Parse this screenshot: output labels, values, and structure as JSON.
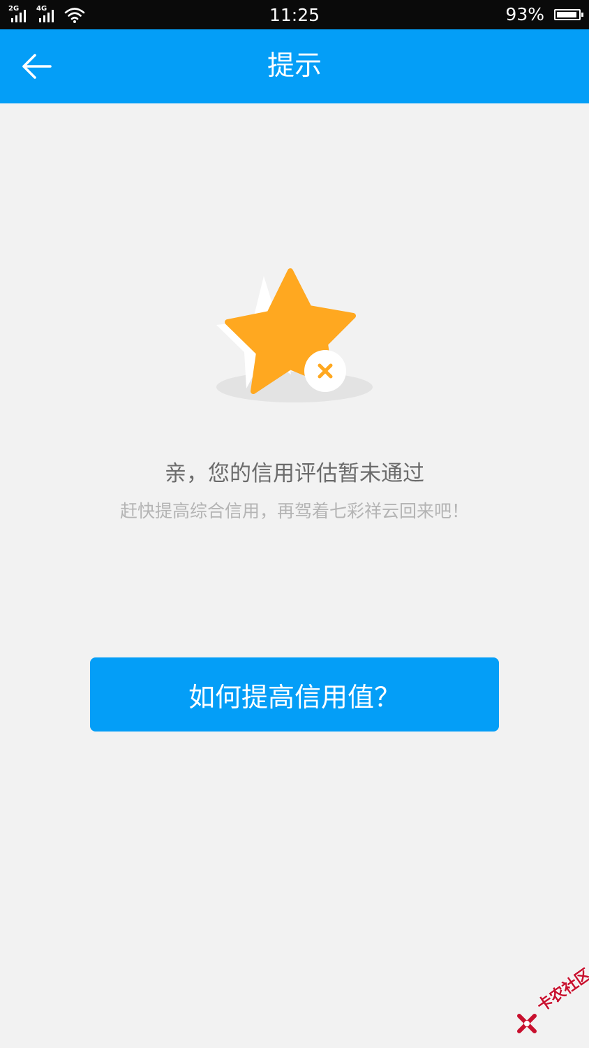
{
  "status_bar": {
    "network_1": "2G",
    "network_2": "4G",
    "time": "11:25",
    "battery": "93%",
    "battery_level": 0.93
  },
  "header": {
    "title": "提示",
    "back_icon": "arrow-left-icon"
  },
  "illustration": {
    "icon": "star-with-x-icon",
    "star_color": "#ffa820",
    "x_color": "#ffa820"
  },
  "message": {
    "title": "亲，您的信用评估暂未通过",
    "subtitle": "赶快提高综合信用，再驾着七彩祥云回来吧！"
  },
  "action": {
    "button_label": "如何提高信用值？"
  },
  "watermark": {
    "text": "卡农社区"
  },
  "colors": {
    "accent": "#049ef7",
    "background": "#f2f2f2"
  }
}
